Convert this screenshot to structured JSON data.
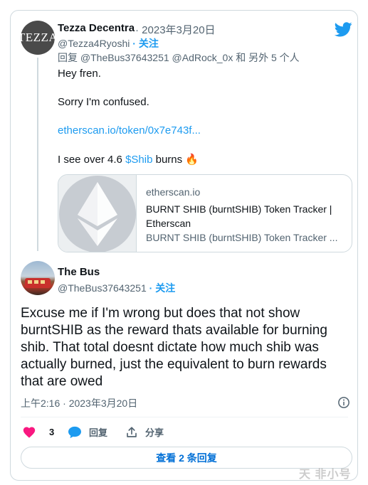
{
  "reply_tweet": {
    "avatar_text": "TEZZA",
    "display_name": "Tezza Decentra",
    "date": "· 2023年3月20日",
    "handle": "@Tezza4Ryoshi",
    "follow_label": "· 关注",
    "replying_to": "回复 @TheBus37643251 @AdRock_0x 和 另外 5 个人",
    "lines": {
      "greeting": "Hey fren.",
      "confused": "Sorry I'm confused.",
      "link": "etherscan.io/token/0x7e743f...",
      "burns_prefix": "I see over 4.6 ",
      "burns_cashtag": "$Shib",
      "burns_suffix": " burns",
      "burns_emoji": "🔥"
    },
    "link_card": {
      "domain": "etherscan.io",
      "title": "BURNT SHIB (burntSHIB) Token Tracker | Etherscan",
      "description": "BURNT SHIB (burntSHIB) Token Tracker ..."
    }
  },
  "main_tweet": {
    "display_name": "The Bus",
    "handle": "@TheBus37643251",
    "follow_label": "· 关注",
    "text": "Excuse me if I'm wrong but does that not show burntSHIB as the reward thats available for burning shib. That total doesnt dictate how much shib was actually burned, just the equivalent to burn rewards that are owed",
    "timestamp": "上午2:16 · 2023年3月20日"
  },
  "actions": {
    "like_count": "3",
    "reply_label": "回复",
    "share_label": "分享"
  },
  "more_replies_label": "查看 2 条回复",
  "watermark": "天 非小号",
  "colors": {
    "accent": "#1d9bf0",
    "like": "#f91880",
    "text": "#0f1419",
    "secondary": "#536471",
    "border": "#cfd9de"
  },
  "icons": {
    "brand": "twitter-bird-icon",
    "info": "info-icon",
    "like": "heart-icon",
    "reply": "speech-bubble-icon",
    "share": "share-icon"
  }
}
